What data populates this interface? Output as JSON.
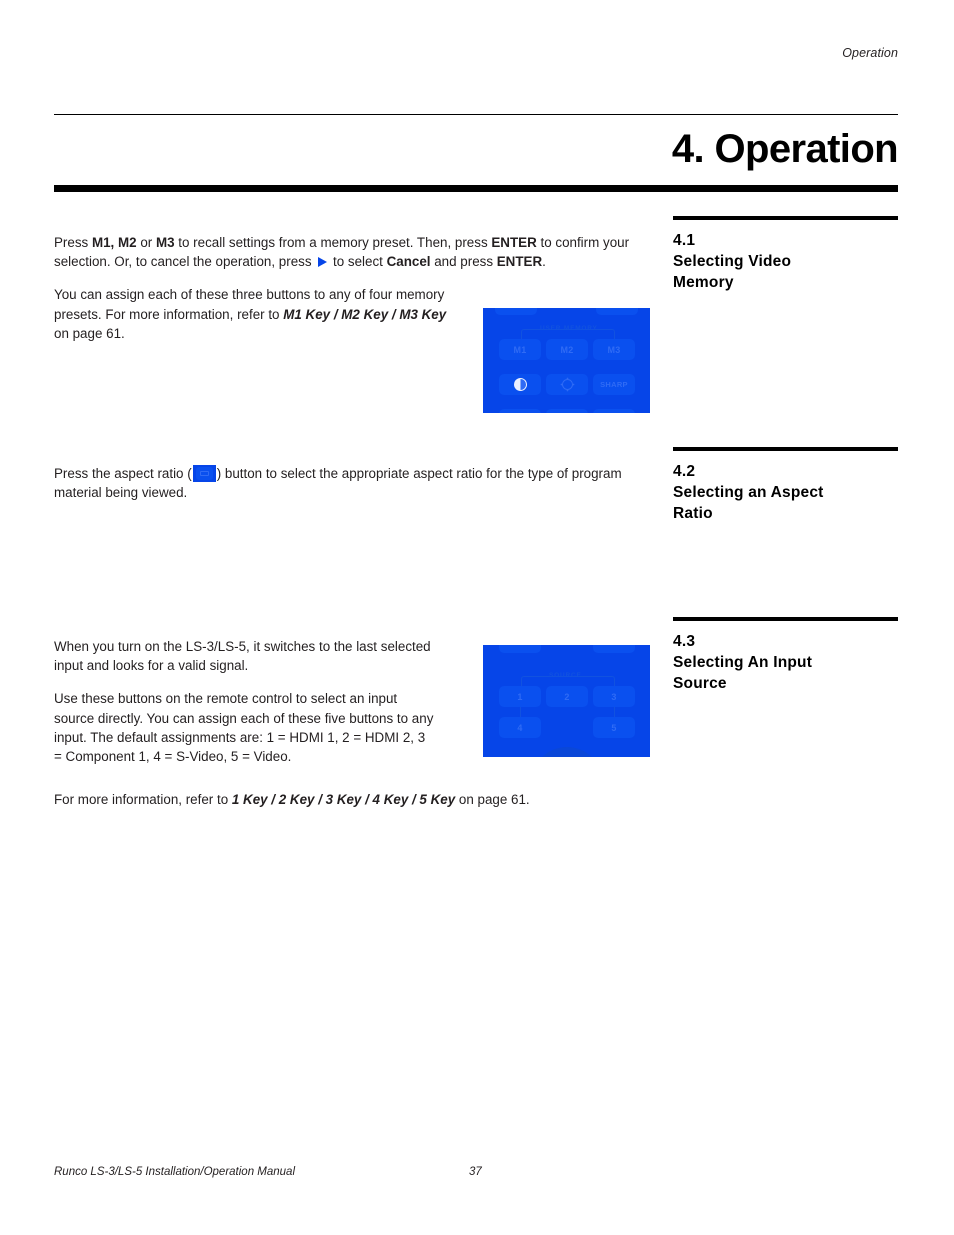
{
  "header": {
    "running_head": "Operation",
    "chapter_title": "4. Operation"
  },
  "sections": [
    {
      "number": "4.1",
      "title_line1": "Selecting Video",
      "title_line2": "Memory"
    },
    {
      "number": "4.2",
      "title_line1": "Selecting an Aspect",
      "title_line2": "Ratio"
    },
    {
      "number": "4.3",
      "title_line1": "Selecting An Input",
      "title_line2": "Source"
    }
  ],
  "body": {
    "p1": {
      "t1": "Press ",
      "b1": "M1, M2",
      "t2": " or ",
      "b2": "M3",
      "t3": " to recall settings from a memory preset. Then, press ",
      "b3": "ENTER",
      "t4": " to confirm your selection. Or, to cancel the operation, press ",
      "icon": "right-arrow-icon",
      "t5": " to select ",
      "b4": "Cancel",
      "t6": " and press ",
      "b5": "ENTER",
      "t7": "."
    },
    "p2": {
      "t1": "You can assign each of these three buttons to any of four memory presets. For more information, refer to ",
      "bi1": "M1 Key / M2 Key / M3 Key",
      "t2": " on page 61."
    },
    "p3": {
      "t1": "Press the aspect ratio (",
      "icon": "aspect-ratio-button-icon",
      "t2": ") button to select the appropriate aspect ratio for the type of program material being viewed."
    },
    "p4": {
      "t1": "When you turn on the LS-3/LS-5, it switches to the last selected input and looks for a valid signal."
    },
    "p5": {
      "t1": "Use these buttons on the remote control to select an input source directly. You can assign each of these five buttons to any input. The default assignments are: 1 = HDMI 1, 2 = HDMI 2, 3 = Component 1, 4 = S-Video, 5 = Video."
    },
    "p6": {
      "t1": "For more information, refer to ",
      "bi1": "1 Key / 2 Key / 3 Key / 4 Key / 5 Key",
      "t2": " on page 61."
    }
  },
  "figures": {
    "remote_memory": {
      "group_label": "USER MEMORY",
      "buttons_row1": [
        "M1",
        "M2",
        "M3"
      ],
      "buttons_row2": [
        "contrast-icon",
        "brightness-icon",
        "SHARP"
      ],
      "sharp_label": "SHARP"
    },
    "remote_source": {
      "group_label": "SOURCE",
      "buttons_row1": [
        "1",
        "2",
        "3"
      ],
      "buttons_row2": [
        "4",
        "5"
      ]
    }
  },
  "colors": {
    "remote_blue": "#0645e8",
    "button_blue": "#0a50ef",
    "button_text": "#2f6bf5",
    "label_blue": "#1152e0",
    "navpad_blue": "#0a47d8",
    "ink": "#231f20"
  },
  "footer": {
    "manual_title": "Runco LS-3/LS-5 Installation/Operation Manual",
    "page_number": "37"
  }
}
